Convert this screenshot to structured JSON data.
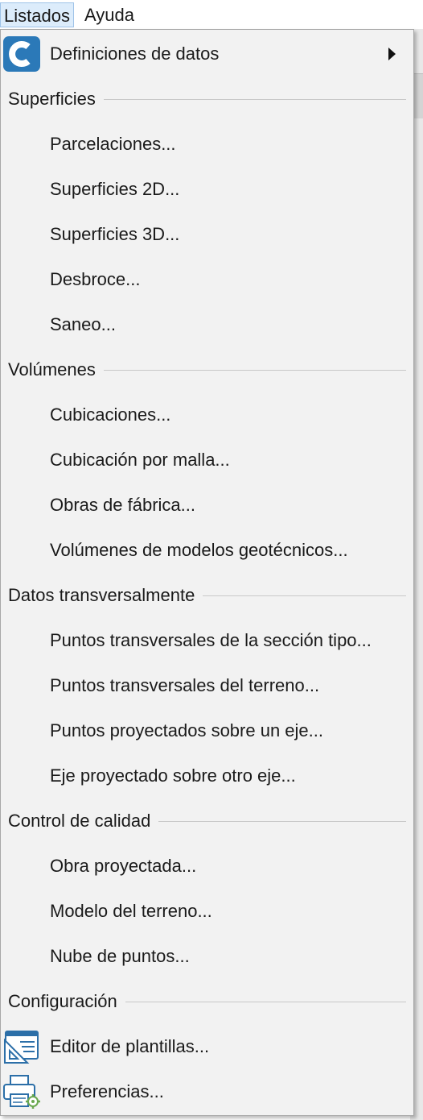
{
  "menubar": {
    "items": [
      {
        "label": "Listados",
        "active": true
      },
      {
        "label": "Ayuda",
        "active": false
      }
    ]
  },
  "menu": {
    "definiciones": {
      "label": "Definiciones de datos",
      "icon": "c-logo-icon",
      "has_submenu": true
    },
    "sections": [
      {
        "title": "Superficies",
        "items": [
          "Parcelaciones...",
          "Superficies 2D...",
          "Superficies 3D...",
          "Desbroce...",
          "Saneo..."
        ]
      },
      {
        "title": "Volúmenes",
        "items": [
          "Cubicaciones...",
          "Cubicación por malla...",
          "Obras de fábrica...",
          "Volúmenes de modelos geotécnicos..."
        ]
      },
      {
        "title": "Datos transversalmente",
        "items": [
          "Puntos transversales de la sección tipo...",
          "Puntos transversales del terreno...",
          "Puntos proyectados sobre un eje...",
          "Eje proyectado sobre otro eje..."
        ]
      },
      {
        "title": "Control de calidad",
        "items": [
          "Obra proyectada...",
          "Modelo del terreno...",
          "Nube de puntos..."
        ]
      },
      {
        "title": "Configuración",
        "items": [
          {
            "label": "Editor de plantillas...",
            "icon": "template-editor-icon"
          },
          {
            "label": "Preferencias...",
            "icon": "preferences-printer-gear-icon"
          }
        ]
      }
    ]
  },
  "colors": {
    "menu_bg": "#f2f2f2",
    "menubar_active": "#dcecfb",
    "logo_blue": "#2b79b8",
    "icon_blue": "#2c6fa8",
    "gear_green": "#6aa84f"
  }
}
